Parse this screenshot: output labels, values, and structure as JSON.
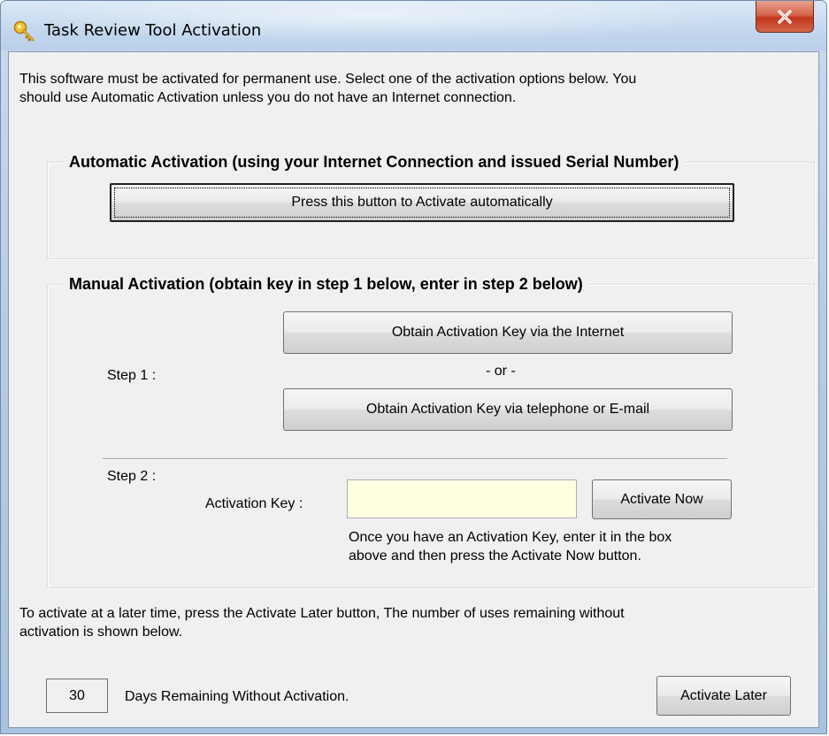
{
  "window": {
    "title": "Task Review Tool Activation",
    "close_label": "X",
    "icon": "key-icon"
  },
  "intro": {
    "line1": "This software must be activated for permanent use. Select one of the activation options below.   You",
    "line2": "should use Automatic Activation unless you do not have an Internet connection."
  },
  "automatic": {
    "legend": "Automatic Activation (using your Internet Connection and issued Serial Number)",
    "button": "Press this button to Activate automatically"
  },
  "manual": {
    "legend": "Manual Activation (obtain key in step 1 below, enter in step 2 below)",
    "step1_label": "Step 1 :",
    "internet_button": "Obtain Activation Key via the Internet",
    "or_text": "- or -",
    "phone_button": "Obtain Activation Key via telephone or E-mail",
    "step2_label": "Step 2 :",
    "key_label": "Activation Key :",
    "key_value": "",
    "activate_button": "Activate Now",
    "hint_line1": "Once you have an Activation Key, enter it in the box",
    "hint_line2": "above and then press the Activate Now button."
  },
  "later": {
    "line1": "To activate at a later time, press the Activate Later button, The number of uses remaining without",
    "line2": "activation is shown below.",
    "days": "30",
    "days_label": "Days Remaining Without Activation.",
    "button": "Activate Later"
  },
  "colors": {
    "input_background": "#ffffe1",
    "close_button": "#c2361b"
  }
}
